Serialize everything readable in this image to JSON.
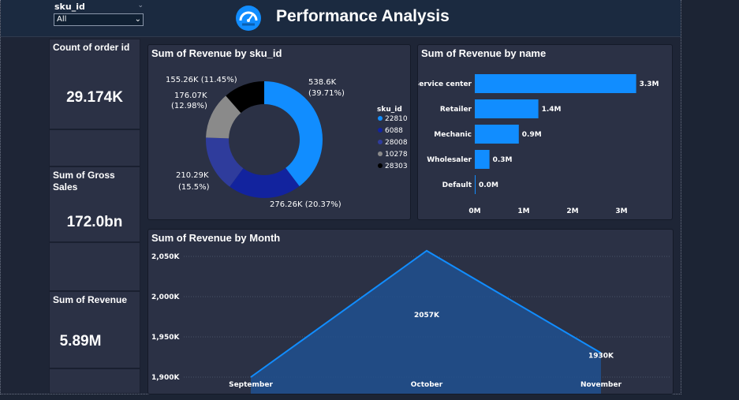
{
  "slicer": {
    "label": "sku_id",
    "selected": "All"
  },
  "header": {
    "title": "Performance Analysis"
  },
  "kpis": [
    {
      "title": "Count of order id",
      "value": "29.174K"
    },
    {
      "title": "Sum of Gross Sales",
      "value": "172.0bn"
    },
    {
      "title": "Sum of Revenue",
      "value": "5.89M"
    }
  ],
  "colors": {
    "accent": "#118dff",
    "background": "#1e2536",
    "card": "#2b3145"
  },
  "donut": {
    "title": "Sum of Revenue by sku_id",
    "legend_title": "sku_id",
    "labels": [
      {
        "line1": "538.6K",
        "line2": "(39.71%)"
      },
      {
        "line1": "276.26K (20.37%)",
        "line2": ""
      },
      {
        "line1": "210.29K",
        "line2": "(15.5%)"
      },
      {
        "line1": "176.07K",
        "line2": "(12.98%)"
      },
      {
        "line1": "155.26K (11.45%)",
        "line2": ""
      }
    ]
  },
  "bar": {
    "title": "Sum of Revenue by name",
    "axis_ticks": [
      "0M",
      "1M",
      "2M",
      "3M"
    ]
  },
  "area": {
    "title": "Sum of Revenue by Month",
    "y_ticks": [
      "2,050K",
      "2,000K",
      "1,950K",
      "1,900K"
    ]
  },
  "chart_data": [
    {
      "type": "pie",
      "title": "Sum of Revenue by sku_id",
      "legend_title": "sku_id",
      "legend_position": "right",
      "slices": [
        {
          "name": "22810",
          "value": 538.6,
          "unit": "K",
          "percent": 39.71,
          "color": "#118dff"
        },
        {
          "name": "6088",
          "value": 276.26,
          "unit": "K",
          "percent": 20.37,
          "color": "#12239e"
        },
        {
          "name": "28008",
          "value": 210.29,
          "unit": "K",
          "percent": 15.5,
          "color": "#2f3c9c"
        },
        {
          "name": "10278",
          "value": 176.07,
          "unit": "K",
          "percent": 12.98,
          "color": "#8a8a8a"
        },
        {
          "name": "28303",
          "value": 155.26,
          "unit": "K",
          "percent": 11.45,
          "color": "#000000"
        }
      ]
    },
    {
      "type": "bar",
      "orientation": "horizontal",
      "title": "Sum of Revenue by name",
      "categories": [
        "Service center",
        "Retailer",
        "Mechanic",
        "Wholesaler",
        "Default"
      ],
      "values": [
        3.3,
        1.3,
        0.9,
        0.3,
        0.0
      ],
      "data_labels": [
        "3.3M",
        "1.4M",
        "0.9M",
        "0.3M",
        "0.0M"
      ],
      "unit": "M",
      "xlim": [
        0,
        3.3
      ],
      "color": "#118dff"
    },
    {
      "type": "area",
      "title": "Sum of Revenue by Month",
      "categories": [
        "September",
        "October",
        "November"
      ],
      "values": [
        1900,
        2057,
        1930
      ],
      "data_labels": [
        "",
        "2057K",
        "1930K"
      ],
      "unit": "K",
      "ylim": [
        1900,
        2060
      ],
      "y_ticks": [
        1900,
        1950,
        2000,
        2050
      ],
      "grid": true,
      "color": "#118dff"
    }
  ]
}
